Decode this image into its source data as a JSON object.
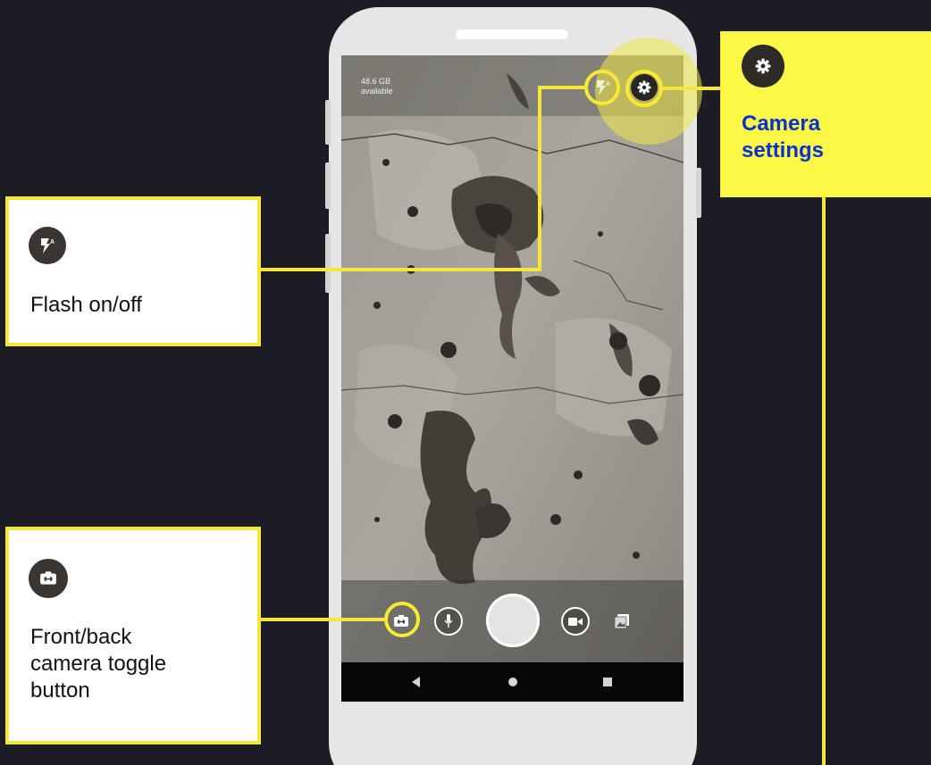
{
  "status": {
    "storage_line1": "48.6 GB",
    "storage_line2": "available"
  },
  "top_controls": [
    {
      "name": "flash-auto",
      "icon": "flash-auto-icon"
    },
    {
      "name": "settings",
      "icon": "gear-icon"
    }
  ],
  "bottom_controls": [
    {
      "name": "camera-switch",
      "icon": "camera-switch-icon"
    },
    {
      "name": "microphone",
      "icon": "microphone-icon"
    },
    {
      "name": "shutter",
      "icon": "shutter-button"
    },
    {
      "name": "video",
      "icon": "video-icon"
    },
    {
      "name": "gallery",
      "icon": "gallery-icon"
    }
  ],
  "nav": [
    "back",
    "home",
    "recents"
  ],
  "callouts": {
    "settings": {
      "icon": "gear-icon",
      "line1": "Camera",
      "line2": "settings"
    },
    "flash": {
      "icon": "flash-auto-icon",
      "text": "Flash on/off"
    },
    "toggle": {
      "icon": "camera-switch-icon",
      "line1": "Front/back",
      "line2": "camera toggle",
      "line3": "button"
    }
  },
  "colors": {
    "background": "#1c1c24",
    "highlight": "#f8ea34",
    "callout_fill_yellow": "#fcf845",
    "callout_text_blue": "#0c2fd2",
    "phone_body": "#e6e6e6"
  }
}
